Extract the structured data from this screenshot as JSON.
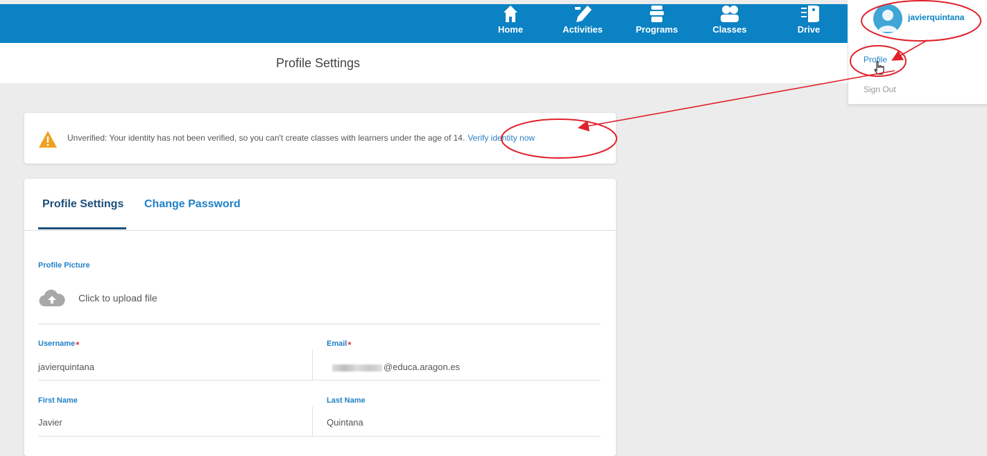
{
  "nav": {
    "items": [
      {
        "label": "Home",
        "icon": "home-icon"
      },
      {
        "label": "Activities",
        "icon": "pencil-icon"
      },
      {
        "label": "Programs",
        "icon": "puzzle-icon"
      },
      {
        "label": "Classes",
        "icon": "users-icon"
      },
      {
        "label": "Drive",
        "icon": "drive-icon"
      }
    ],
    "username": "javierquintana"
  },
  "dropdown": {
    "profile": "Profile",
    "signout": "Sign Out"
  },
  "page": {
    "title": "Profile Settings"
  },
  "alert": {
    "text": "Unverified: Your identity has not been verified, so you can't create classes with learners under the age of 14.",
    "link": "Verify identity now"
  },
  "tabs": {
    "profile_settings": "Profile Settings",
    "change_password": "Change Password"
  },
  "form": {
    "profile_picture_label": "Profile Picture",
    "upload_text": "Click to upload file",
    "username_label": "Username",
    "username_value": "javierquintana",
    "email_label": "Email",
    "email_value_visible": "@educa.aragon.es",
    "first_name_label": "First Name",
    "first_name_value": "Javier",
    "last_name_label": "Last Name",
    "last_name_value": "Quintana",
    "required_marker": "*"
  },
  "colors": {
    "nav_bg": "#0b82c4",
    "accent": "#1f80c7",
    "tab_active": "#1b4f7a",
    "warning": "#f0a020",
    "required": "#e03a3a",
    "annotation": "#e0202a"
  }
}
